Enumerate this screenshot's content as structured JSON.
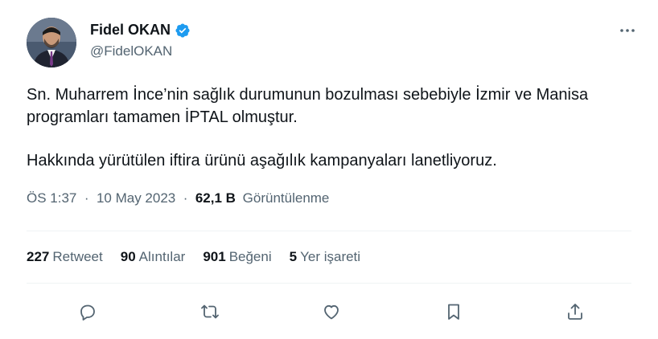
{
  "author": {
    "name": "Fidel OKAN",
    "handle": "@FidelOKAN",
    "verified": true
  },
  "tweet": {
    "paragraphs": [
      "Sn. Muharrem İnce’nin sağlık durumunun bozulması sebebiyle İzmir ve Manisa programları tamamen İPTAL olmuştur.",
      "Hakkında yürütülen iftira ürünü aşağılık kampanyaları lanetliyoruz."
    ],
    "time": "ÖS 1:37",
    "separator": "·",
    "date": "10 May 2023",
    "views_count": "62,1 B",
    "views_label": "Görüntülenme"
  },
  "stats": {
    "retweets_count": "227",
    "retweets_label": "Retweet",
    "quotes_count": "90",
    "quotes_label": "Alıntılar",
    "likes_count": "901",
    "likes_label": "Beğeni",
    "bookmarks_count": "5",
    "bookmarks_label": "Yer işareti"
  },
  "icons": {
    "verified": "verified-badge-icon",
    "more": "more-horizontal-icon",
    "reply": "reply-icon",
    "retweet": "retweet-icon",
    "like": "heart-icon",
    "bookmark": "bookmark-icon",
    "share": "share-icon"
  },
  "colors": {
    "verified_blue": "#1d9bf0",
    "text_primary": "#0f1419",
    "text_secondary": "#536471",
    "divider": "#eff3f4"
  }
}
